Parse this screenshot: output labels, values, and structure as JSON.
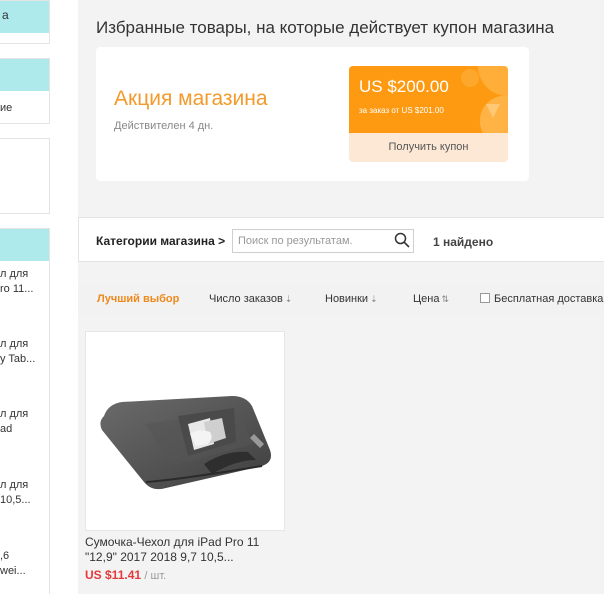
{
  "sidebar": {
    "box1_label": "а",
    "box2_label": "ие",
    "items": [
      {
        "line1": "л для",
        "line2": "ro 11..."
      },
      {
        "line1": "л для",
        "line2": "y Tab..."
      },
      {
        "line1": "л для",
        "line2": "ad"
      },
      {
        "line1": "л для",
        "line2": "10,5..."
      },
      {
        "line1": ",6",
        "line2": "wei..."
      }
    ]
  },
  "promo": {
    "title": "Избранные товары, на которые действует купон магазина",
    "name": "Акция магазина",
    "valid": "Действителен 4 дн.",
    "coupon": {
      "amount": "US $200.00",
      "condition": "за заказ от US $201.00",
      "button": "Получить купон"
    }
  },
  "search": {
    "categories_label": "Категории магазина >",
    "placeholder": "Поиск по результатам.",
    "value": "",
    "found": "1 найдено"
  },
  "sort": {
    "best": "Лучший выбор",
    "orders": "Число заказов",
    "newest": "Новинки",
    "price": "Цена",
    "free_shipping": "Бесплатная доставка",
    "down_arrow": "⇣",
    "updown_arrow": "⇅"
  },
  "product": {
    "title": "Сумочка-Чехол для iPad Pro 11 \"12,9\" 2017 2018 9,7 10,5...",
    "price": "US $11.41",
    "unit": "/ шт."
  },
  "colors": {
    "accent": "#f39a2b",
    "coupon": "#fd9a12",
    "coupon_button": "#fde8d6",
    "price": "#e4393c",
    "sidebar_header": "#aee9ec"
  }
}
